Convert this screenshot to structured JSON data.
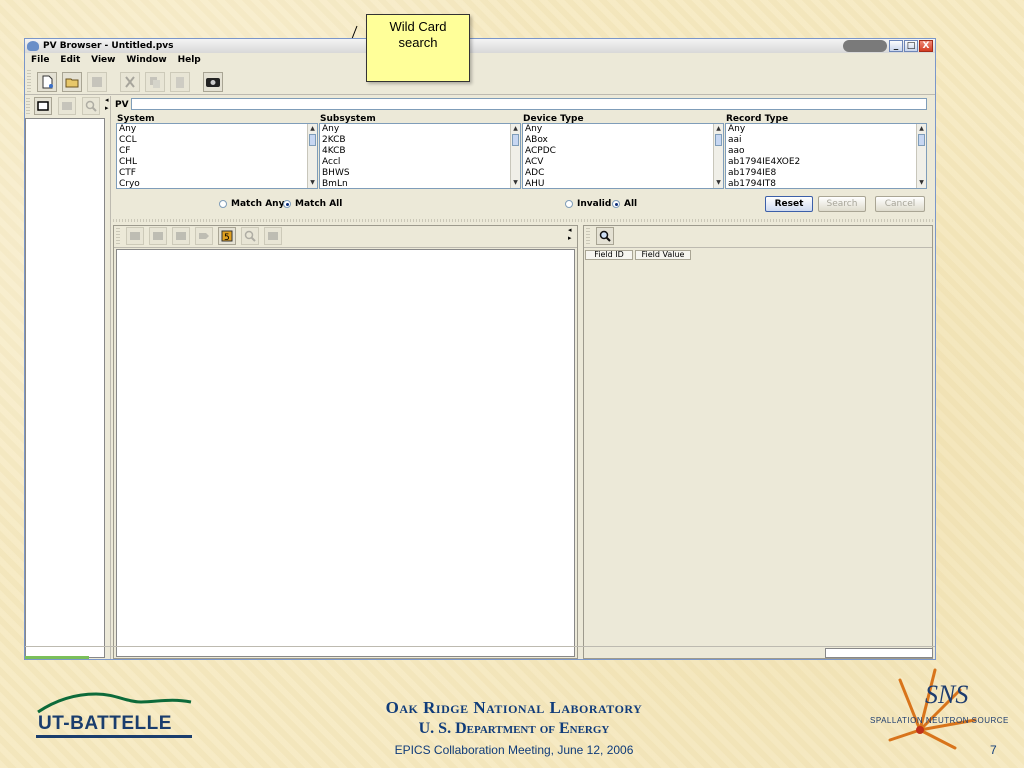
{
  "window": {
    "title": "PV Browser - Untitled.pvs",
    "controls": {
      "minimize": "_",
      "maximize": "□",
      "close": "X"
    }
  },
  "menubar": [
    "File",
    "Edit",
    "View",
    "Window",
    "Help"
  ],
  "toolbar": {
    "icons": [
      "new-file-icon",
      "open-folder-icon",
      "save-icon",
      "cut-icon",
      "copy-icon",
      "paste-icon",
      "camera-icon"
    ]
  },
  "left_toolbar": {
    "icons": [
      "window-icon",
      "list-icon",
      "search-icon"
    ]
  },
  "search": {
    "pv_label": "PV",
    "pv_value": "",
    "columns": [
      {
        "label": "System",
        "items": [
          "Any",
          "CCL",
          "CF",
          "CHL",
          "CTF",
          "Cryo"
        ]
      },
      {
        "label": "Subsystem",
        "items": [
          "Any",
          "2KCB",
          "4KCB",
          "Accl",
          "BHWS",
          "BmLn"
        ]
      },
      {
        "label": "Device Type",
        "items": [
          "Any",
          "ABox",
          "ACPDC",
          "ACV",
          "ADC",
          "AHU"
        ]
      },
      {
        "label": "Record Type",
        "items": [
          "Any",
          "aai",
          "aao",
          "ab1794IE4XOE2",
          "ab1794IE8",
          "ab1794IT8"
        ]
      }
    ],
    "match_any": "Match Any",
    "match_all": "Match All",
    "match_selected": "all",
    "invalid": "Invalid",
    "all": "All",
    "validity_selected": "all",
    "reset": "Reset",
    "search_btn": "Search",
    "cancel": "Cancel"
  },
  "results": {
    "toolbar_icons": [
      "table-icon",
      "table-icon",
      "table-icon",
      "tag-icon",
      "export-icon",
      "search-icon",
      "list-icon"
    ]
  },
  "details": {
    "columns": [
      "Field ID",
      "Field Value"
    ]
  },
  "callout": {
    "line1": "Wild Card",
    "line2": "search"
  },
  "footer": {
    "org_line1": "Oak Ridge National Laboratory",
    "org_line2": "U. S. Department of Energy",
    "meeting": "EPICS Collaboration Meeting, June 12, 2006",
    "page": "7",
    "left_logo": "UT-BATTELLE",
    "right_logo": "SNS",
    "right_logo_sub": "SPALLATION NEUTRON SOURCE"
  },
  "colors": {
    "accent": "#103c7a",
    "callout": "#ffff99",
    "window_bg": "#ece9d8"
  }
}
